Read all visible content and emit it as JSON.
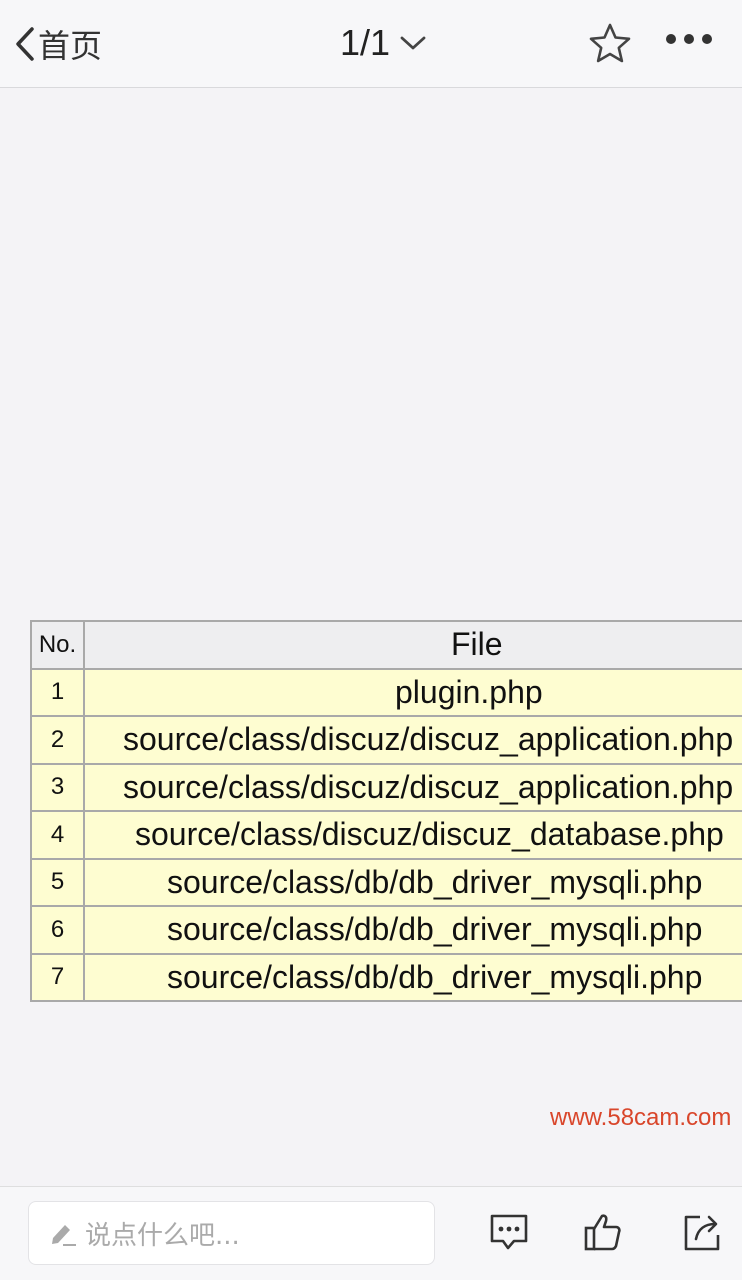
{
  "header": {
    "back_label": "首页",
    "page_indicator": "1/1"
  },
  "table": {
    "headers": {
      "no": "No.",
      "file": "File"
    },
    "rows": [
      {
        "no": "1",
        "file": "plugin.php",
        "indent": 310
      },
      {
        "no": "2",
        "file": "source/class/discuz/discuz_application.php",
        "indent": 38
      },
      {
        "no": "3",
        "file": "source/class/discuz/discuz_application.php",
        "indent": 38
      },
      {
        "no": "4",
        "file": "source/class/discuz/discuz_database.php",
        "indent": 50
      },
      {
        "no": "5",
        "file": "source/class/db/db_driver_mysqli.php",
        "indent": 82
      },
      {
        "no": "6",
        "file": "source/class/db/db_driver_mysqli.php",
        "indent": 82
      },
      {
        "no": "7",
        "file": "source/class/db/db_driver_mysqli.php",
        "indent": 82
      }
    ]
  },
  "watermark": "www.58cam.com",
  "footer": {
    "comment_placeholder": "说点什么吧..."
  },
  "icons": {
    "back": "chevron-left-icon",
    "pager": "chevron-down-icon",
    "favorite": "star-icon",
    "more": "more-dots-icon",
    "edit": "pencil-icon",
    "comments": "comment-bubble-icon",
    "like": "thumbs-up-icon",
    "share": "share-icon"
  }
}
